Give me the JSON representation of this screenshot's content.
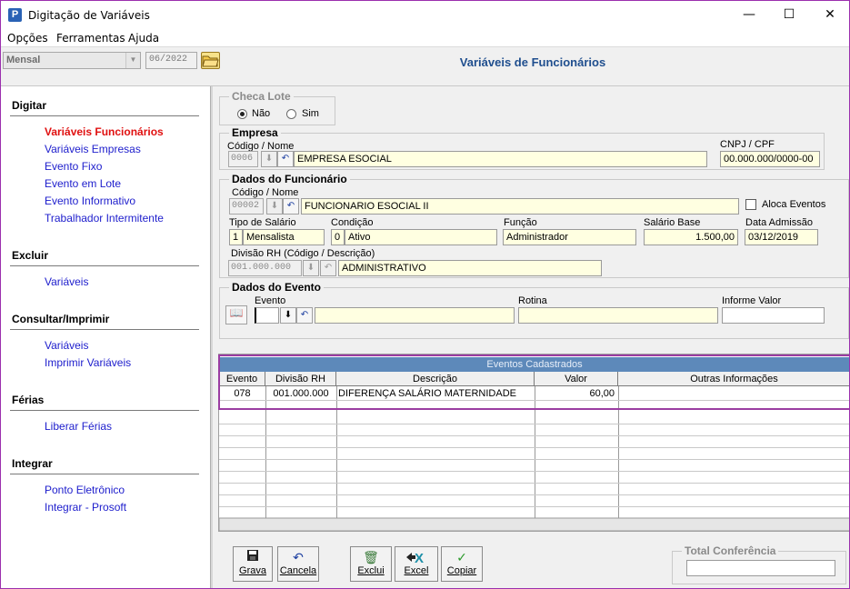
{
  "window": {
    "title": "Digitação de Variáveis",
    "controls": {
      "minimize": "—",
      "maximize": "☐",
      "close": "✕"
    }
  },
  "menu": [
    "Opções",
    "Ferramentas",
    "Ajuda"
  ],
  "toolbar": {
    "period_select": "Mensal",
    "period_date": "06/2022",
    "open_folder_icon": "folder-open-icon"
  },
  "page_title": "Variáveis de Funcionários",
  "sidebar": {
    "sections": [
      {
        "title": "Digitar",
        "items": [
          {
            "label": "Variáveis Funcionários",
            "active": true
          },
          {
            "label": "Variáveis Empresas",
            "active": false
          },
          {
            "label": "Evento Fixo",
            "active": false
          },
          {
            "label": "Evento em Lote",
            "active": false
          },
          {
            "label": "Evento Informativo",
            "active": false
          },
          {
            "label": "Trabalhador Intermitente",
            "active": false
          }
        ]
      },
      {
        "title": "Excluir",
        "items": [
          {
            "label": "Variáveis",
            "active": false
          }
        ]
      },
      {
        "title": "Consultar/Imprimir",
        "items": [
          {
            "label": "Variáveis",
            "active": false
          },
          {
            "label": "Imprimir Variáveis",
            "active": false
          }
        ]
      },
      {
        "title": "Férias",
        "items": [
          {
            "label": "Liberar Férias",
            "active": false
          }
        ]
      },
      {
        "title": "Integrar",
        "items": [
          {
            "label": "Ponto Eletrônico",
            "active": false
          },
          {
            "label": "Integrar - Prosoft",
            "active": false
          }
        ]
      }
    ]
  },
  "checa_lote": {
    "title": "Checa Lote",
    "options": [
      "Não",
      "Sim"
    ],
    "selected": "Não"
  },
  "empresa": {
    "title": "Empresa",
    "code_label": "Código / Nome",
    "code": "0006",
    "name": "EMPRESA ESOCIAL",
    "cnpj_label": "CNPJ / CPF",
    "cnpj": "00.000.000/0000-00"
  },
  "funcionario": {
    "title": "Dados do Funcionário",
    "code_label": "Código / Nome",
    "code": "00002",
    "name": "FUNCIONARIO ESOCIAL II",
    "aloca_eventos_label": "Aloca Eventos",
    "aloca_eventos_checked": false,
    "tipo_salario_label": "Tipo de Salário",
    "tipo_salario_code": "1",
    "tipo_salario": "Mensalista",
    "condicao_label": "Condição",
    "condicao_code": "0",
    "condicao": "Ativo",
    "funcao_label": "Função",
    "funcao": "Administrador",
    "salario_base_label": "Salário Base",
    "salario_base": "1.500,00",
    "data_admissao_label": "Data Admissão",
    "data_admissao": "03/12/2019",
    "divisao_label": "Divisão RH (Código / Descrição)",
    "divisao_code": "001.000.000",
    "divisao_desc": "ADMINISTRATIVO"
  },
  "evento": {
    "title": "Dados do Evento",
    "evento_label": "Evento",
    "evento_value": "",
    "rotina_label": "Rotina",
    "rotina_value": "",
    "informe_valor_label": "Informe Valor",
    "informe_valor": ""
  },
  "grid": {
    "caption": "Eventos Cadastrados",
    "columns": [
      "Evento",
      "Divisão RH",
      "Descrição",
      "Valor",
      "Outras Informações"
    ],
    "rows": [
      {
        "evento": "078",
        "divisao": "001.000.000",
        "descricao": "DIFERENÇA SALÁRIO MATERNIDADE",
        "valor": "60,00",
        "outras": ""
      }
    ]
  },
  "buttons": {
    "grava": "Grava",
    "cancela": "Cancela",
    "exclui": "Exclui",
    "excel": "Excel",
    "copiar": "Copiar"
  },
  "total_conferencia": {
    "title": "Total Conferência",
    "value": ""
  }
}
